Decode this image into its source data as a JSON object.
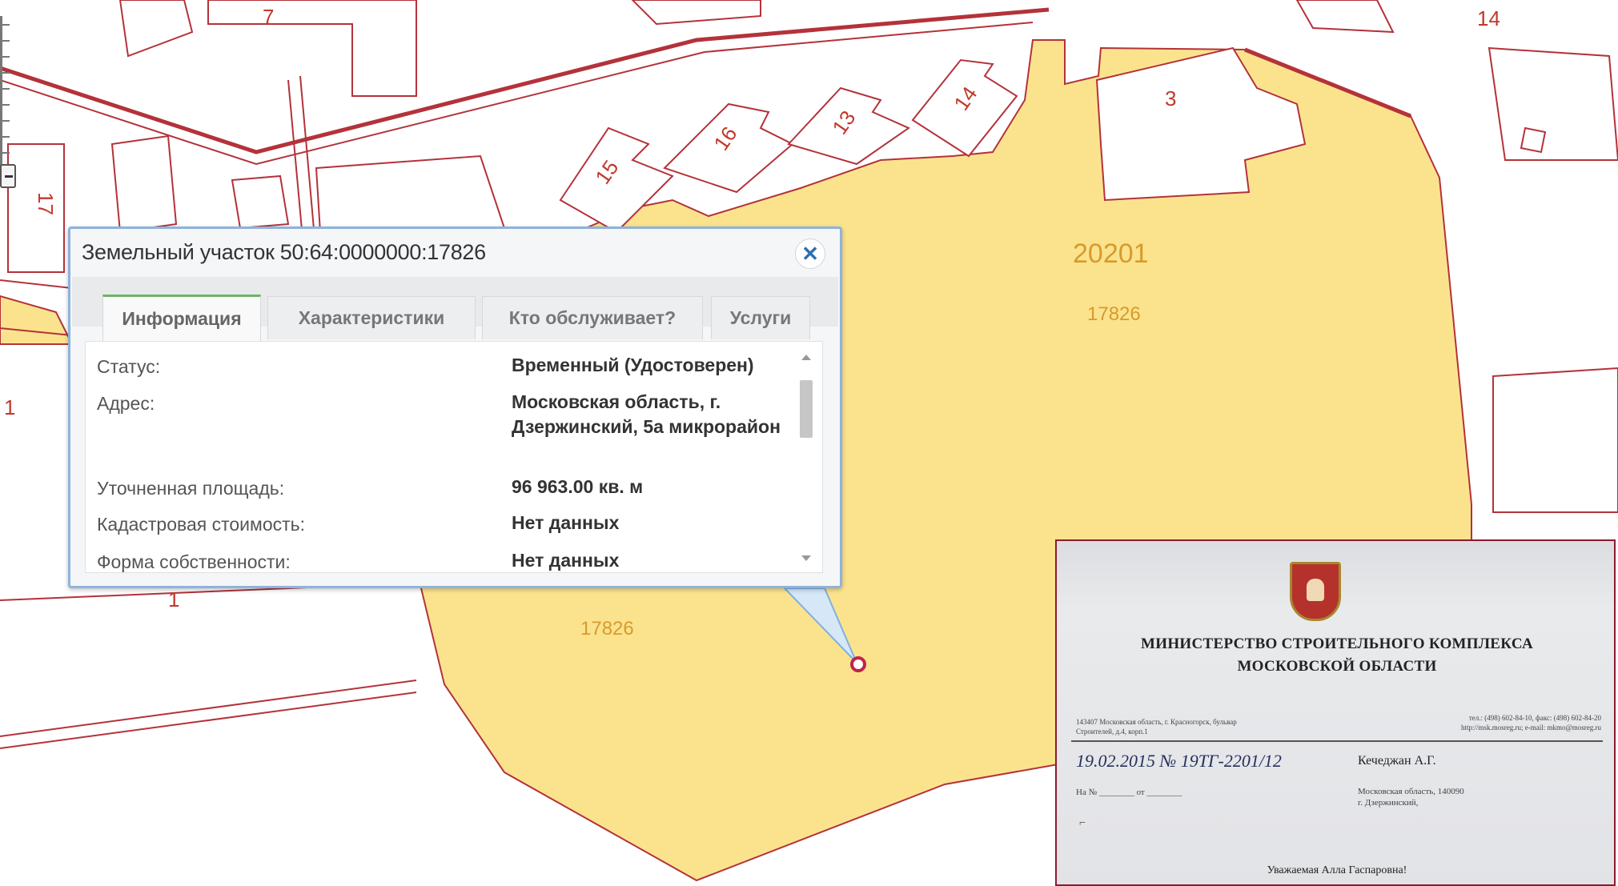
{
  "map": {
    "plot_labels": {
      "p7": "7",
      "p14_top": "14",
      "p3": "3",
      "p17": "17",
      "p15": "15",
      "p16": "16",
      "p13": "13",
      "p14": "14",
      "p1_left": "1",
      "p1_bottom": "1",
      "block": "20201",
      "parcel_upper": "17826",
      "parcel_lower": "17826"
    },
    "colors": {
      "parcel_fill": "#fbe38e",
      "boundary": "#b4323a",
      "label_orange": "#d99a2b"
    }
  },
  "popup": {
    "title": "Земельный участок 50:64:0000000:17826",
    "close_icon": "close-icon",
    "tabs": [
      {
        "label": "Информация",
        "active": true
      },
      {
        "label": "Характеристики",
        "active": false
      },
      {
        "label": "Кто обслуживает?",
        "active": false
      },
      {
        "label": "Услуги",
        "active": false
      }
    ],
    "rows": [
      {
        "label": "Статус:",
        "value": "Временный (Удостоверен)"
      },
      {
        "label": "Адрес:",
        "value": "Московская область, г. Дзержинский, 5а микрорайон"
      },
      {
        "label": "Уточненная площадь:",
        "value": "96 963.00 кв. м"
      },
      {
        "label": "Кадастровая стоимость:",
        "value": "Нет данных"
      },
      {
        "label": "Форма собственности:",
        "value": "Нет данных"
      }
    ]
  },
  "letter": {
    "ministry_line1": "МИНИСТЕРСТВО СТРОИТЕЛЬНОГО КОМПЛЕКСА",
    "ministry_line2": "МОСКОВСКОЙ ОБЛАСТИ",
    "address_left": "143407 Московская область, г. Красногорск, бульвар Строителей, д.4, корп.1",
    "address_right": "тел.: (498) 602-84-10, факс: (498) 602-84-20\nhttp://msk.mosreg.ru; e-mail: mkmo@mosreg.ru",
    "date_number": "19.02.2015 № 19ТГ-2201/12",
    "ref_line": "На № ________ от ________",
    "recipient": "Кечеджан А.Г.",
    "recipient_address": "Московская область, 140090\nг. Дзержинский,",
    "greeting": "Уважаемая Алла Гаспаровна!"
  }
}
